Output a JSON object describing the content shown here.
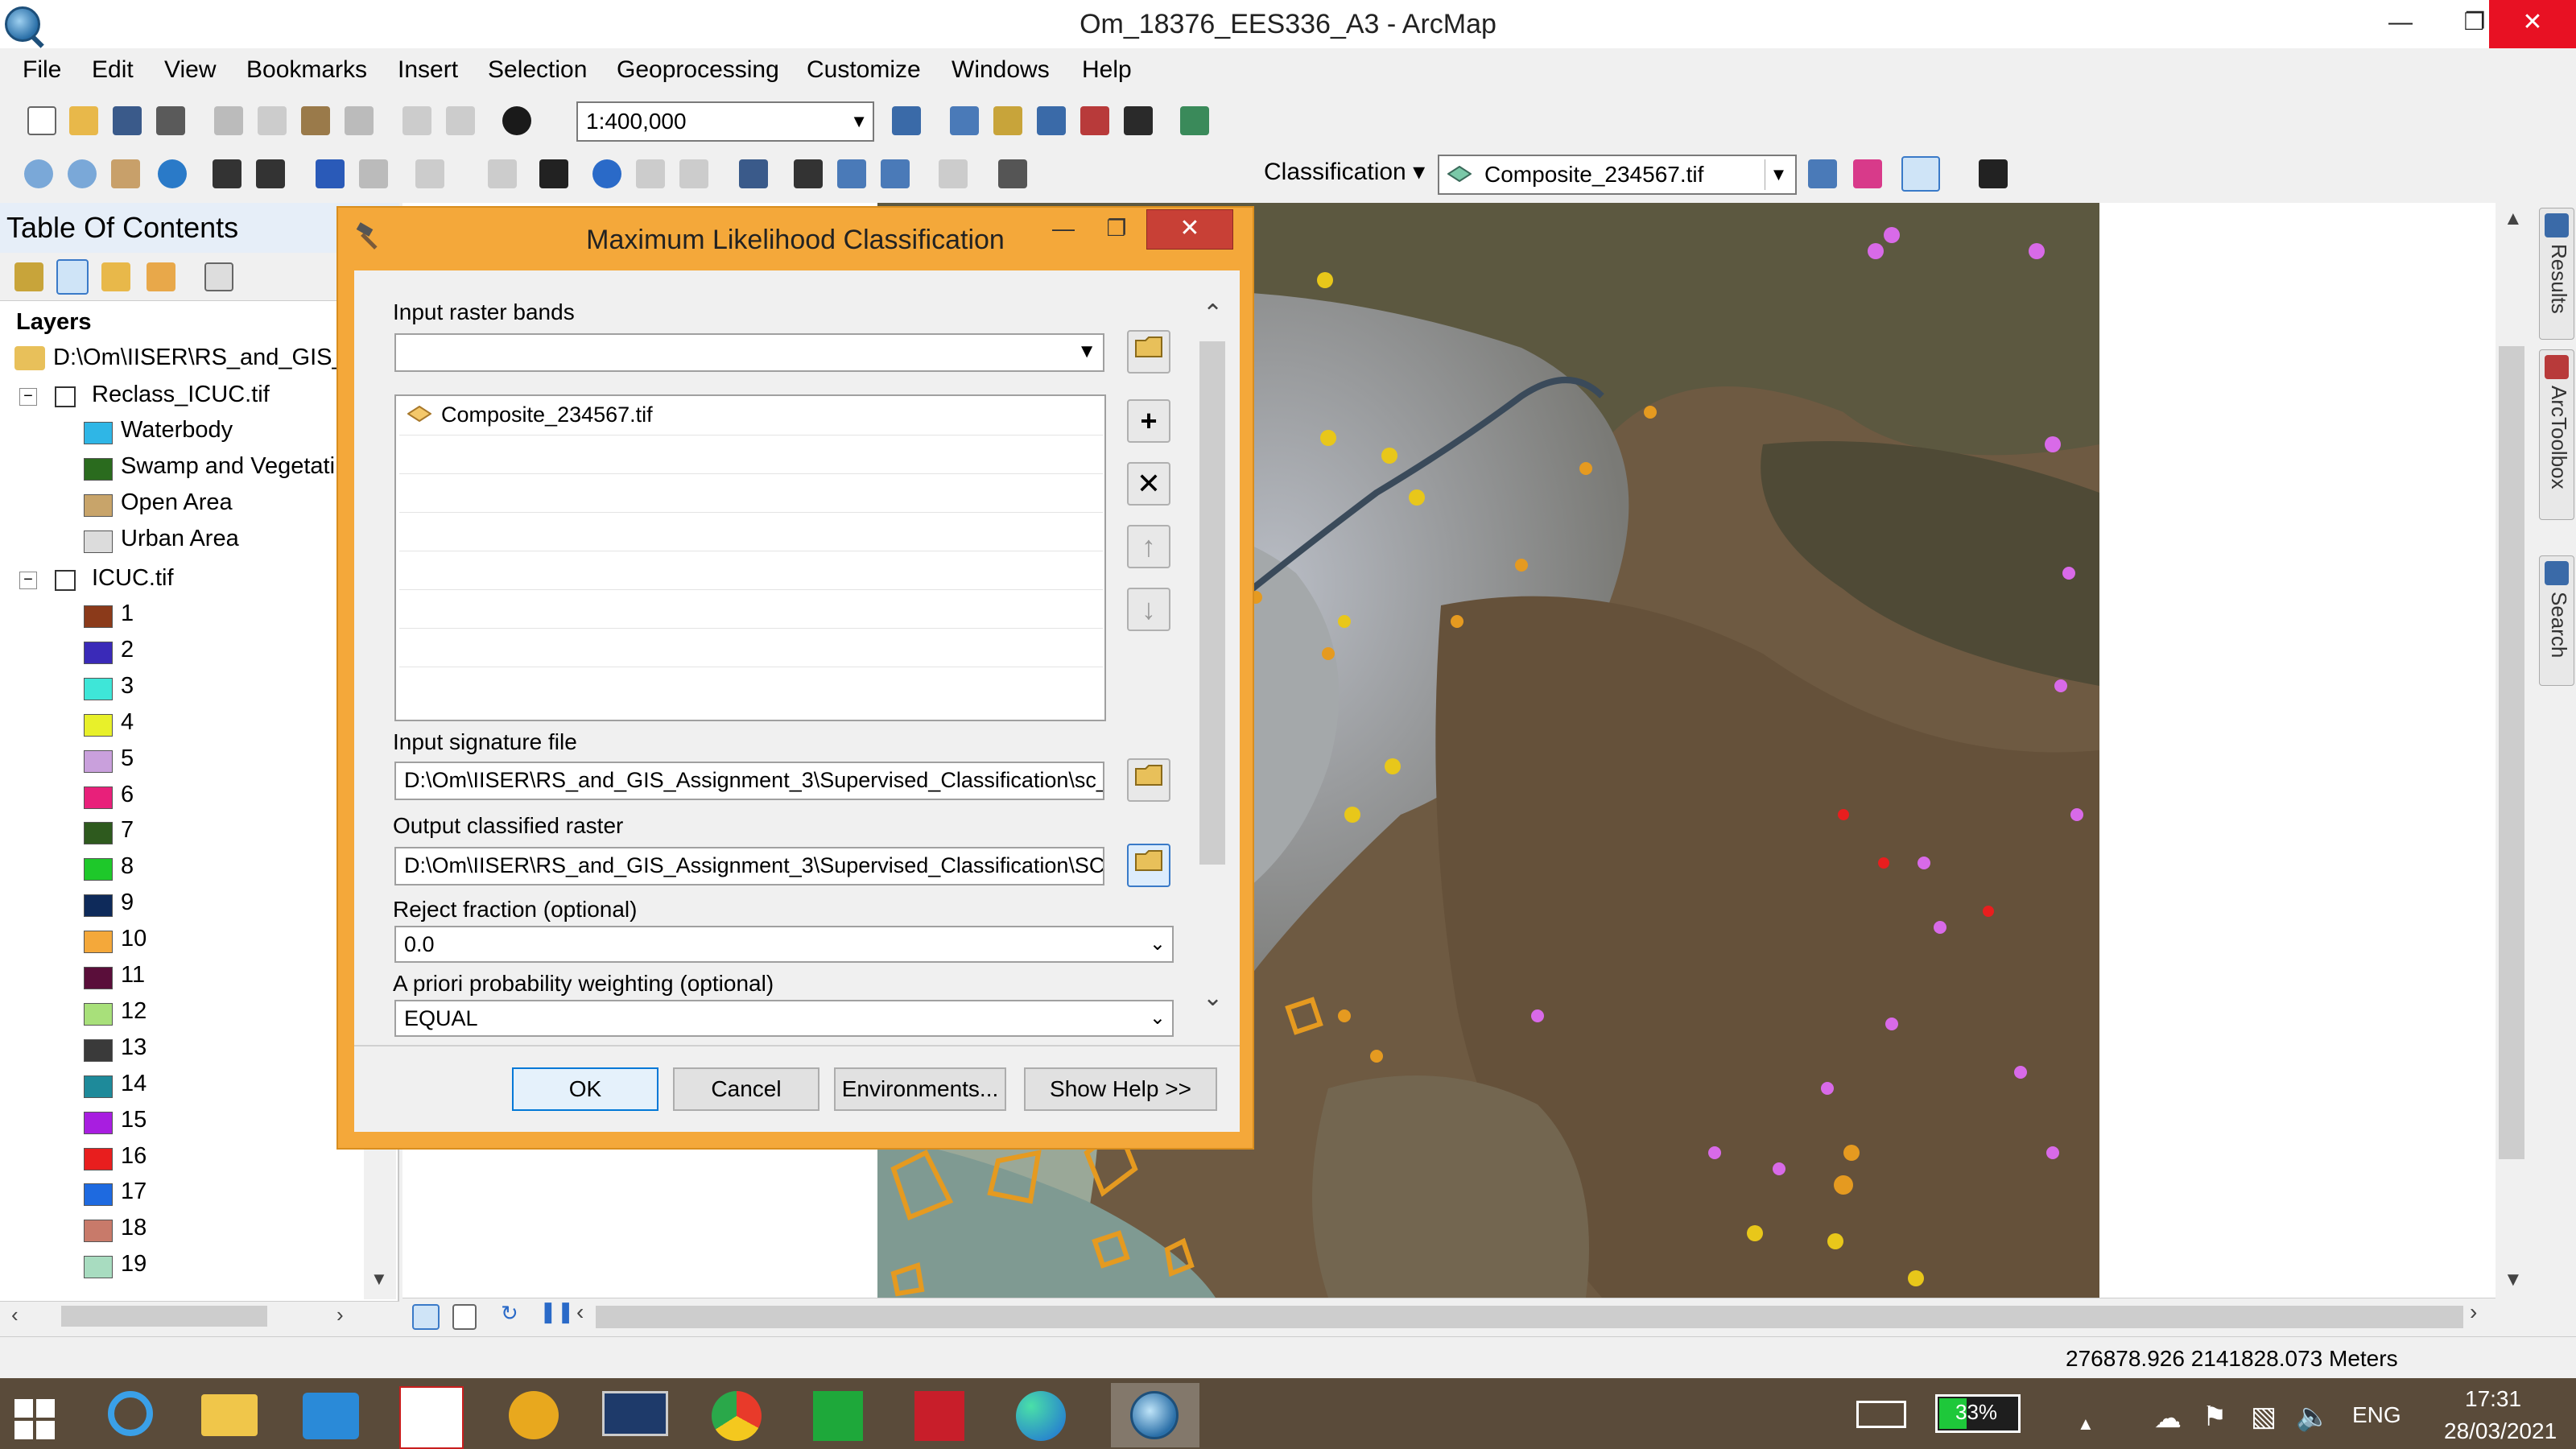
{
  "window": {
    "title": "Om_18376_EES336_A3 - ArcMap",
    "minimize": "—",
    "maximize": "❐",
    "close": "✕"
  },
  "menu": [
    "File",
    "Edit",
    "View",
    "Bookmarks",
    "Insert",
    "Selection",
    "Geoprocessing",
    "Customize",
    "Windows",
    "Help"
  ],
  "toolbar": {
    "scale": "1:400,000",
    "classification_label": "Classification ▾",
    "classification_layer": "Composite_234567.tif"
  },
  "toc": {
    "title": "Table Of Contents",
    "layers_label": "Layers",
    "folder_path": "D:\\Om\\IISER\\RS_and_GIS_A",
    "reclass_layer": "Reclass_ICUC.tif",
    "reclass_classes": [
      {
        "label": "Waterbody",
        "color": "#2fb6e6"
      },
      {
        "label": "Swamp and Vegetati",
        "color": "#2a6b1e"
      },
      {
        "label": "Open Area",
        "color": "#c8a46a"
      },
      {
        "label": "Urban Area",
        "color": "#dcdcdc"
      }
    ],
    "icuc_layer": "ICUC.tif",
    "icuc_classes": [
      {
        "label": "1",
        "color": "#8b3a1a"
      },
      {
        "label": "2",
        "color": "#3a2ab8"
      },
      {
        "label": "3",
        "color": "#3ee6d8"
      },
      {
        "label": "4",
        "color": "#e8f02a"
      },
      {
        "label": "5",
        "color": "#c9a0dc"
      },
      {
        "label": "6",
        "color": "#e8207a"
      },
      {
        "label": "7",
        "color": "#2e5a1e"
      },
      {
        "label": "8",
        "color": "#1ec82a"
      },
      {
        "label": "9",
        "color": "#0e2a5a"
      },
      {
        "label": "10",
        "color": "#f4a83a"
      },
      {
        "label": "11",
        "color": "#5a0e3a"
      },
      {
        "label": "12",
        "color": "#a8e07a"
      },
      {
        "label": "13",
        "color": "#3a3a3a"
      },
      {
        "label": "14",
        "color": "#1e8a9a"
      },
      {
        "label": "15",
        "color": "#a81ee0"
      },
      {
        "label": "16",
        "color": "#e81e1e"
      },
      {
        "label": "17",
        "color": "#1e6ae0"
      },
      {
        "label": "18",
        "color": "#c87a6a"
      },
      {
        "label": "19",
        "color": "#a8dcc0"
      }
    ]
  },
  "dialog": {
    "title": "Maximum Likelihood Classification",
    "input_bands_label": "Input raster bands",
    "input_bands_value": "",
    "band_list": [
      "Composite_234567.tif"
    ],
    "signature_label": "Input signature file",
    "signature_value": "D:\\Om\\IISER\\RS_and_GIS_Assignment_3\\Supervised_Classification\\sc_:",
    "output_label": "Output classified raster",
    "output_value": "D:\\Om\\IISER\\RS_and_GIS_Assignment_3\\Supervised_Classification\\SC_",
    "reject_label": "Reject fraction (optional)",
    "reject_value": "0.0",
    "apriori_label": "A priori probability weighting (optional)",
    "apriori_value": "EQUAL",
    "ok": "OK",
    "cancel": "Cancel",
    "environments": "Environments...",
    "show_help": "Show Help >>"
  },
  "side_tabs": [
    "Results",
    "ArcToolbox",
    "Search"
  ],
  "status": {
    "coords": "276878.926  2141828.073 Meters"
  },
  "taskbar": {
    "battery": "33%",
    "language": "ENG",
    "time": "17:31",
    "date": "28/03/2021"
  }
}
